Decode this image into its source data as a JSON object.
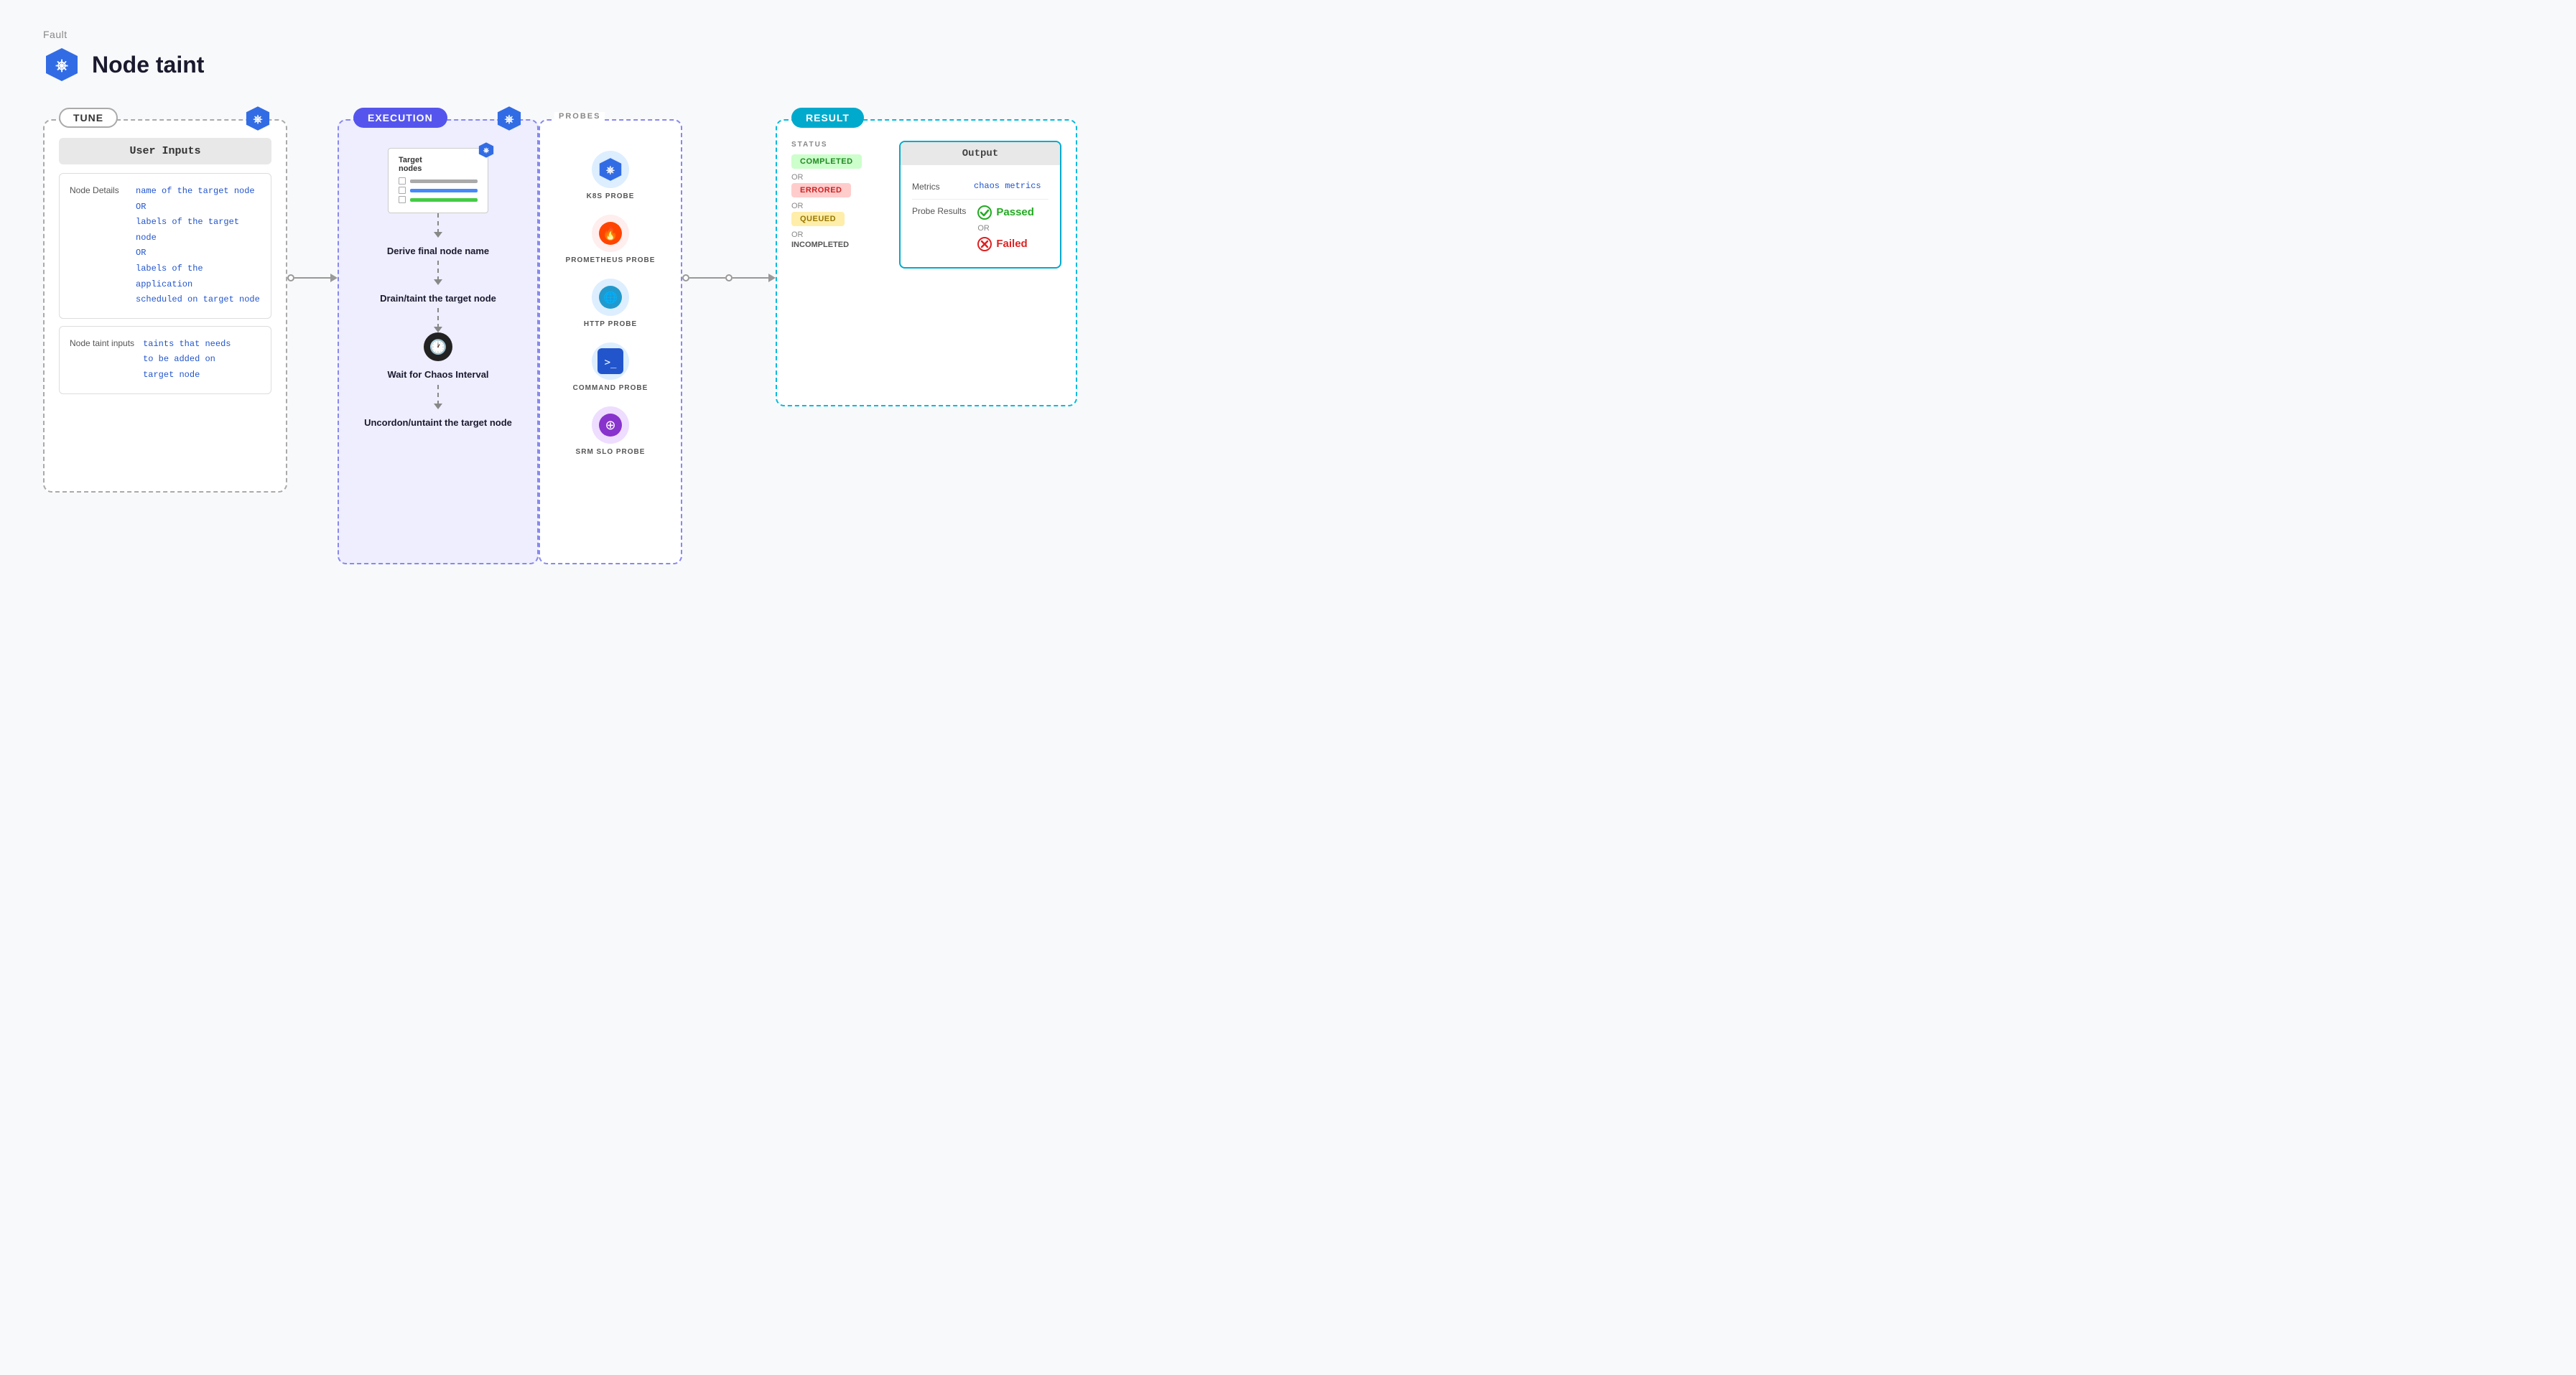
{
  "page": {
    "label": "Fault",
    "title": "Node taint"
  },
  "tune": {
    "badge": "TUNE",
    "user_inputs_header": "User Inputs",
    "rows": [
      {
        "label": "Node Details",
        "values": [
          "name of the target node",
          "OR",
          "labels of the target node",
          "OR",
          "labels of the application scheduled on target node"
        ]
      },
      {
        "label": "Node taint inputs",
        "values": [
          "taints that needs to be added on target node"
        ]
      }
    ]
  },
  "execution": {
    "badge": "EXECUTION",
    "steps": [
      "Derive final node name",
      "Drain/taint the target node",
      "Wait for Chaos Interval",
      "Uncordon/untaint the target node"
    ]
  },
  "probes": {
    "section_label": "PROBES",
    "items": [
      {
        "name": "K8S PROBE",
        "color": "#2255cc",
        "icon": "⎈"
      },
      {
        "name": "PROMETHEUS PROBE",
        "color": "#ff4400",
        "icon": "🔥"
      },
      {
        "name": "HTTP PROBE",
        "color": "#2299cc",
        "icon": "🌐"
      },
      {
        "name": "COMMAND PROBE",
        "color": "#2255cc",
        "icon": ">_"
      },
      {
        "name": "SRM SLO PROBE",
        "color": "#8833cc",
        "icon": "⊕"
      }
    ]
  },
  "result": {
    "badge": "RESULT",
    "status_label": "STATUS",
    "statuses": [
      {
        "label": "COMPLETED",
        "type": "completed"
      },
      {
        "label": "OR",
        "type": "or"
      },
      {
        "label": "ERRORED",
        "type": "errored"
      },
      {
        "label": "OR",
        "type": "or"
      },
      {
        "label": "QUEUED",
        "type": "queued"
      },
      {
        "label": "OR",
        "type": "or"
      },
      {
        "label": "INCOMPLETED",
        "type": "incompleted"
      }
    ],
    "output": {
      "header": "Output",
      "metrics_label": "Metrics",
      "metrics_value": "chaos metrics",
      "probe_results_label": "Probe Results",
      "passed_label": "Passed",
      "or_label": "OR",
      "failed_label": "Failed"
    }
  }
}
